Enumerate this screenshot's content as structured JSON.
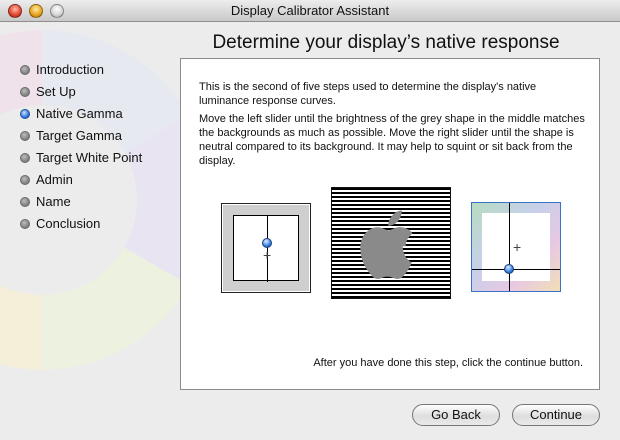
{
  "window": {
    "title": "Display Calibrator Assistant"
  },
  "steps": [
    {
      "label": "Introduction",
      "active": false
    },
    {
      "label": "Set Up",
      "active": false
    },
    {
      "label": "Native Gamma",
      "active": true
    },
    {
      "label": "Target Gamma",
      "active": false
    },
    {
      "label": "Target White Point",
      "active": false
    },
    {
      "label": "Admin",
      "active": false
    },
    {
      "label": "Name",
      "active": false
    },
    {
      "label": "Conclusion",
      "active": false
    }
  ],
  "main": {
    "heading": "Determine your display’s native response",
    "intro": "This is the second of five steps used to determine the display's native luminance response curves.",
    "instructions": "Move the left slider until the brightness of the grey shape in the middle matches the backgrounds as much as possible.  Move the right slider until the shape is neutral compared to its background.  It may help to squint or sit back from the display.",
    "footer_note": "After you have done this step, click the continue button."
  },
  "buttons": {
    "back_label": "Go Back",
    "continue_label": "Continue"
  },
  "icons": {
    "close": "close-icon",
    "minimize": "minimize-icon",
    "zoom": "zoom-icon",
    "apple": "apple-logo-icon"
  },
  "colors": {
    "active_step": "#2b6fd8",
    "inactive_step": "#7d7d7d",
    "right_box_border": "#3a72c9"
  }
}
